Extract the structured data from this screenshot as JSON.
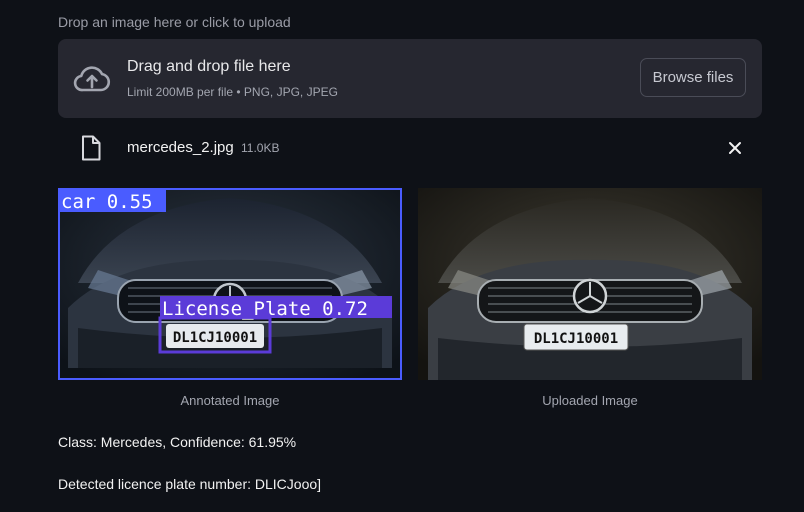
{
  "uploader": {
    "label": "Drop an image here or click to upload",
    "title": "Drag and drop file here",
    "subtitle": "Limit 200MB per file • PNG, JPG, JPEG",
    "browse_label": "Browse files",
    "icon": "cloud-upload-icon"
  },
  "file": {
    "name": "mercedes_2.jpg",
    "size": "11.0KB",
    "icon": "file-icon",
    "remove_icon": "close-icon"
  },
  "images": {
    "annotated": {
      "caption": "Annotated Image",
      "car_label": "car 0.55",
      "plate_label": "License_Plate 0.72",
      "plate_text": "DL1CJ10001",
      "box_color": "#4a5cff"
    },
    "uploaded": {
      "caption": "Uploaded Image",
      "plate_text": "DL1CJ10001"
    }
  },
  "results": {
    "classification": "Class: Mercedes, Confidence: 61.95%",
    "plate": "Detected licence plate number: DLICJooo]"
  }
}
